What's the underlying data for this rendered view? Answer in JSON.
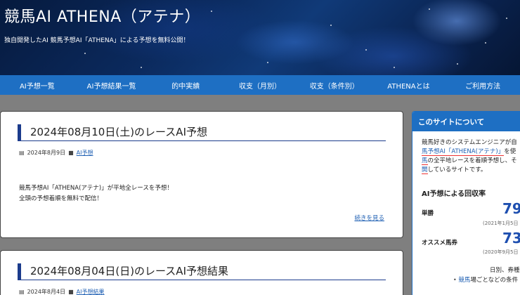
{
  "header": {
    "title": "競馬AI ATHENA（アテナ）",
    "description": "独自開発したAI 競馬予想AI「ATHENA」による予想を無料公開！"
  },
  "nav": {
    "items": [
      "AI予想一覧",
      "AI予想結果一覧",
      "的中実績",
      "収支（月別）",
      "収支（条件別）",
      "ATHENAとは",
      "ご利用方法"
    ]
  },
  "posts": [
    {
      "title": "2024年08月10日(土)のレースAI予想",
      "date": "2024年8月9日",
      "category": "AI予想",
      "excerpt_line1": "競馬予想AI「ATHENA(アテナ)」が平地全レースを予想！",
      "excerpt_line2": "全頭の予想着順を無料で配信！",
      "read_more": "続きを見る"
    },
    {
      "title": "2024年08月04日(日)のレースAI予想結果",
      "date": "2024年8月4日",
      "category": "AI予想結果"
    }
  ],
  "sidebar": {
    "heading": "このサイトについて",
    "intro_line1": "競馬好きのシステムエンジニアが自",
    "intro_line2_link": "馬予想AI「ATHENA(アテナ)」",
    "intro_line2_rest": "を使",
    "intro_line3_link": "馬",
    "intro_line3_rest": "の全平地レースを着順予想し、そ",
    "intro_line4_link": "開",
    "intro_line4_rest": "しているサイトです。",
    "recovery_heading": "AI予想による回収率",
    "row1_label": "単勝",
    "row1_value": "79",
    "row1_note": "(2021年1月5日",
    "row2_label": "オススメ馬券",
    "row2_value": "73",
    "row2_note": "(2020年9月5日",
    "footer_line1": "日別、券種",
    "footer_line2_link": "競馬",
    "footer_line2_rest": "場ごとなどの条件"
  },
  "colors": {
    "nav_bg": "#1e6fc3",
    "title_accent": "#1b3b8c",
    "link": "#1e5fb3",
    "big_number": "#1e4fb0"
  }
}
